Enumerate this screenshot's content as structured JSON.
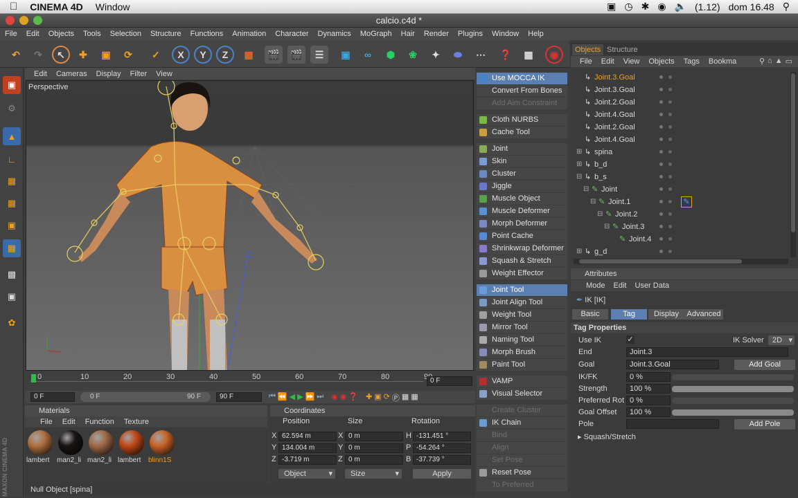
{
  "mac": {
    "app_name": "CINEMA 4D",
    "menu_window": "Window",
    "battery": "(1.12)",
    "clock": "dom 16.48"
  },
  "window": {
    "title": "calcio.c4d *"
  },
  "menubar": [
    "File",
    "Edit",
    "Objects",
    "Tools",
    "Selection",
    "Structure",
    "Functions",
    "Animation",
    "Character",
    "Dynamics",
    "MoGraph",
    "Hair",
    "Render",
    "Plugins",
    "Window",
    "Help"
  ],
  "viewport": {
    "menu": [
      "Edit",
      "Cameras",
      "Display",
      "Filter",
      "View"
    ],
    "label": "Perspective"
  },
  "timeline": {
    "ticks": [
      "0",
      "10",
      "20",
      "30",
      "40",
      "50",
      "60",
      "70",
      "80",
      "90"
    ],
    "current_frame": "0 F",
    "start_field": "0 F",
    "range_start": "0 F",
    "range_end": "90 F",
    "end_field": "90 F"
  },
  "materials": {
    "title": "Materials",
    "menu": [
      "File",
      "Edit",
      "Function",
      "Texture"
    ],
    "items": [
      {
        "label": "lambert",
        "color": "#b07040"
      },
      {
        "label": "man2_li",
        "color": "#1a1414"
      },
      {
        "label": "man2_li",
        "color": "#a06a48"
      },
      {
        "label": "lambert",
        "color": "#c04818"
      },
      {
        "label": "blinn1S",
        "color": "#c86428"
      }
    ]
  },
  "coordinates": {
    "title": "Coordinates",
    "headers": [
      "Position",
      "Size",
      "Rotation"
    ],
    "rows": [
      {
        "axis": "X",
        "pos": "62.594 m",
        "size": "0 m",
        "rot_axis": "H",
        "rot": "-131.451 °"
      },
      {
        "axis": "Y",
        "pos": "134.004 m",
        "size": "0 m",
        "rot_axis": "P",
        "rot": "-54.264 °"
      },
      {
        "axis": "Z",
        "pos": "-3.719 m",
        "size": "0 m",
        "rot_axis": "B",
        "rot": "-37.739 °"
      }
    ],
    "mode_select": "Object",
    "size_select": "Size",
    "apply": "Apply"
  },
  "status": "Null Object [spina]",
  "maxon_logo": "MAXON CINEMA 4D",
  "palette": {
    "groups": [
      [
        {
          "label": "Use MOCCA IK",
          "state": "sel",
          "color": "#4a82c8"
        },
        {
          "label": "Convert From Bones",
          "state": "",
          "color": ""
        },
        {
          "label": "Add Aim Constraint",
          "state": "dis",
          "color": ""
        }
      ],
      [
        {
          "label": "Cloth NURBS",
          "state": "",
          "color": "#7ab84a"
        },
        {
          "label": "Cache Tool",
          "state": "",
          "color": "#c8a040"
        }
      ],
      [
        {
          "label": "Joint",
          "state": "",
          "color": "#8aaa5a"
        },
        {
          "label": "Skin",
          "state": "",
          "color": "#7a9ad0"
        },
        {
          "label": "Cluster",
          "state": "",
          "color": "#6a8ac0"
        },
        {
          "label": "Jiggle",
          "state": "",
          "color": "#6a7ac8"
        },
        {
          "label": "Muscle Object",
          "state": "",
          "color": "#5aa050"
        },
        {
          "label": "Muscle Deformer",
          "state": "",
          "color": "#5a90d0"
        },
        {
          "label": "Morph Deformer",
          "state": "",
          "color": "#7a8ac0"
        },
        {
          "label": "Point Cache",
          "state": "",
          "color": "#5a8ad0"
        },
        {
          "label": "Shrinkwrap Deformer",
          "state": "",
          "color": "#8a7ac8"
        },
        {
          "label": "Squash & Stretch",
          "state": "",
          "color": "#8a9ad0"
        },
        {
          "label": "Weight Effector",
          "state": "",
          "color": "#9a9a9a"
        }
      ],
      [
        {
          "label": "Joint Tool",
          "state": "sel",
          "color": "#6a9ad8"
        },
        {
          "label": "Joint Align Tool",
          "state": "",
          "color": "#7a9ac0"
        },
        {
          "label": "Weight Tool",
          "state": "",
          "color": "#a0a0a0"
        },
        {
          "label": "Mirror Tool",
          "state": "",
          "color": "#9a9aaa"
        },
        {
          "label": "Naming Tool",
          "state": "",
          "color": "#aaaaaa"
        },
        {
          "label": "Morph Brush",
          "state": "",
          "color": "#8a8ab8"
        },
        {
          "label": "Paint Tool",
          "state": "",
          "color": "#a08a60"
        }
      ],
      [
        {
          "label": "VAMP",
          "state": "",
          "color": "#b03030"
        },
        {
          "label": "Visual Selector",
          "state": "",
          "color": "#8aa0c8"
        }
      ],
      [
        {
          "label": "Create Cluster",
          "state": "dis",
          "color": ""
        },
        {
          "label": "IK Chain",
          "state": "",
          "color": "#6a9ad0"
        },
        {
          "label": "Bind",
          "state": "dis",
          "color": ""
        },
        {
          "label": "Align",
          "state": "dis",
          "color": ""
        },
        {
          "label": "Set Pose",
          "state": "dis",
          "color": ""
        },
        {
          "label": "Reset Pose",
          "state": "",
          "color": "#9a9a9a"
        },
        {
          "label": "To Preferred",
          "state": "dis",
          "color": ""
        }
      ]
    ]
  },
  "objects": {
    "tabs": [
      "Objects",
      "Structure"
    ],
    "menu": [
      "File",
      "Edit",
      "View",
      "Objects",
      "Tags",
      "Bookma"
    ],
    "rows": [
      {
        "label": "Joint.3.Goal",
        "indent": 0,
        "highlight": true,
        "expander": ""
      },
      {
        "label": "Joint.3.Goal",
        "indent": 0,
        "highlight": false,
        "expander": ""
      },
      {
        "label": "Joint.2.Goal",
        "indent": 0,
        "highlight": false,
        "expander": ""
      },
      {
        "label": "Joint.4.Goal",
        "indent": 0,
        "highlight": false,
        "expander": ""
      },
      {
        "label": "Joint.2.Goal",
        "indent": 0,
        "highlight": false,
        "expander": ""
      },
      {
        "label": "Joint.4.Goal",
        "indent": 0,
        "highlight": false,
        "expander": ""
      },
      {
        "label": "spina",
        "indent": 0,
        "highlight": false,
        "expander": "+"
      },
      {
        "label": "b_d",
        "indent": 0,
        "highlight": false,
        "expander": "+"
      },
      {
        "label": "b_s",
        "indent": 0,
        "highlight": false,
        "expander": "-"
      },
      {
        "label": "Joint",
        "indent": 1,
        "highlight": false,
        "expander": "-"
      },
      {
        "label": "Joint.1",
        "indent": 2,
        "highlight": false,
        "expander": "-"
      },
      {
        "label": "Joint.2",
        "indent": 3,
        "highlight": false,
        "expander": "-"
      },
      {
        "label": "Joint.3",
        "indent": 4,
        "highlight": false,
        "expander": "-"
      },
      {
        "label": "Joint.4",
        "indent": 5,
        "highlight": false,
        "expander": ""
      },
      {
        "label": "g_d",
        "indent": 0,
        "highlight": false,
        "expander": "+"
      }
    ]
  },
  "attributes": {
    "title": "Attributes",
    "menu": [
      "Mode",
      "Edit",
      "User Data"
    ],
    "object_name": "IK [IK]",
    "tabs": [
      "Basic",
      "Tag",
      "Display",
      "Advanced"
    ],
    "section": "Tag Properties",
    "use_ik_label": "Use IK",
    "use_ik_check": "✓",
    "ik_solver_label": "IK Solver",
    "ik_solver_value": "2D",
    "end_label": "End",
    "end_value": "Joint.3",
    "goal_label": "Goal",
    "goal_value": "Joint.3.Goal",
    "add_goal": "Add Goal",
    "ikfk_label": "IK/FK",
    "ikfk_value": "0 %",
    "ikfk_level": 0,
    "strength_label": "Strength",
    "strength_value": "100 %",
    "strength_level": 1,
    "pref_label": "Preferred Rot",
    "pref_value": "0 %",
    "pref_level": 0,
    "goaloff_label": "Goal Offset",
    "goaloff_value": "100 %",
    "goaloff_level": 1,
    "pole_label": "Pole",
    "add_pole": "Add Pole",
    "squash": "Squash/Stretch"
  },
  "colors": {
    "selected_blue": "#5a7fb0",
    "accent_orange": "#f0a020",
    "ik_goal_yellow": "#e8d060"
  }
}
